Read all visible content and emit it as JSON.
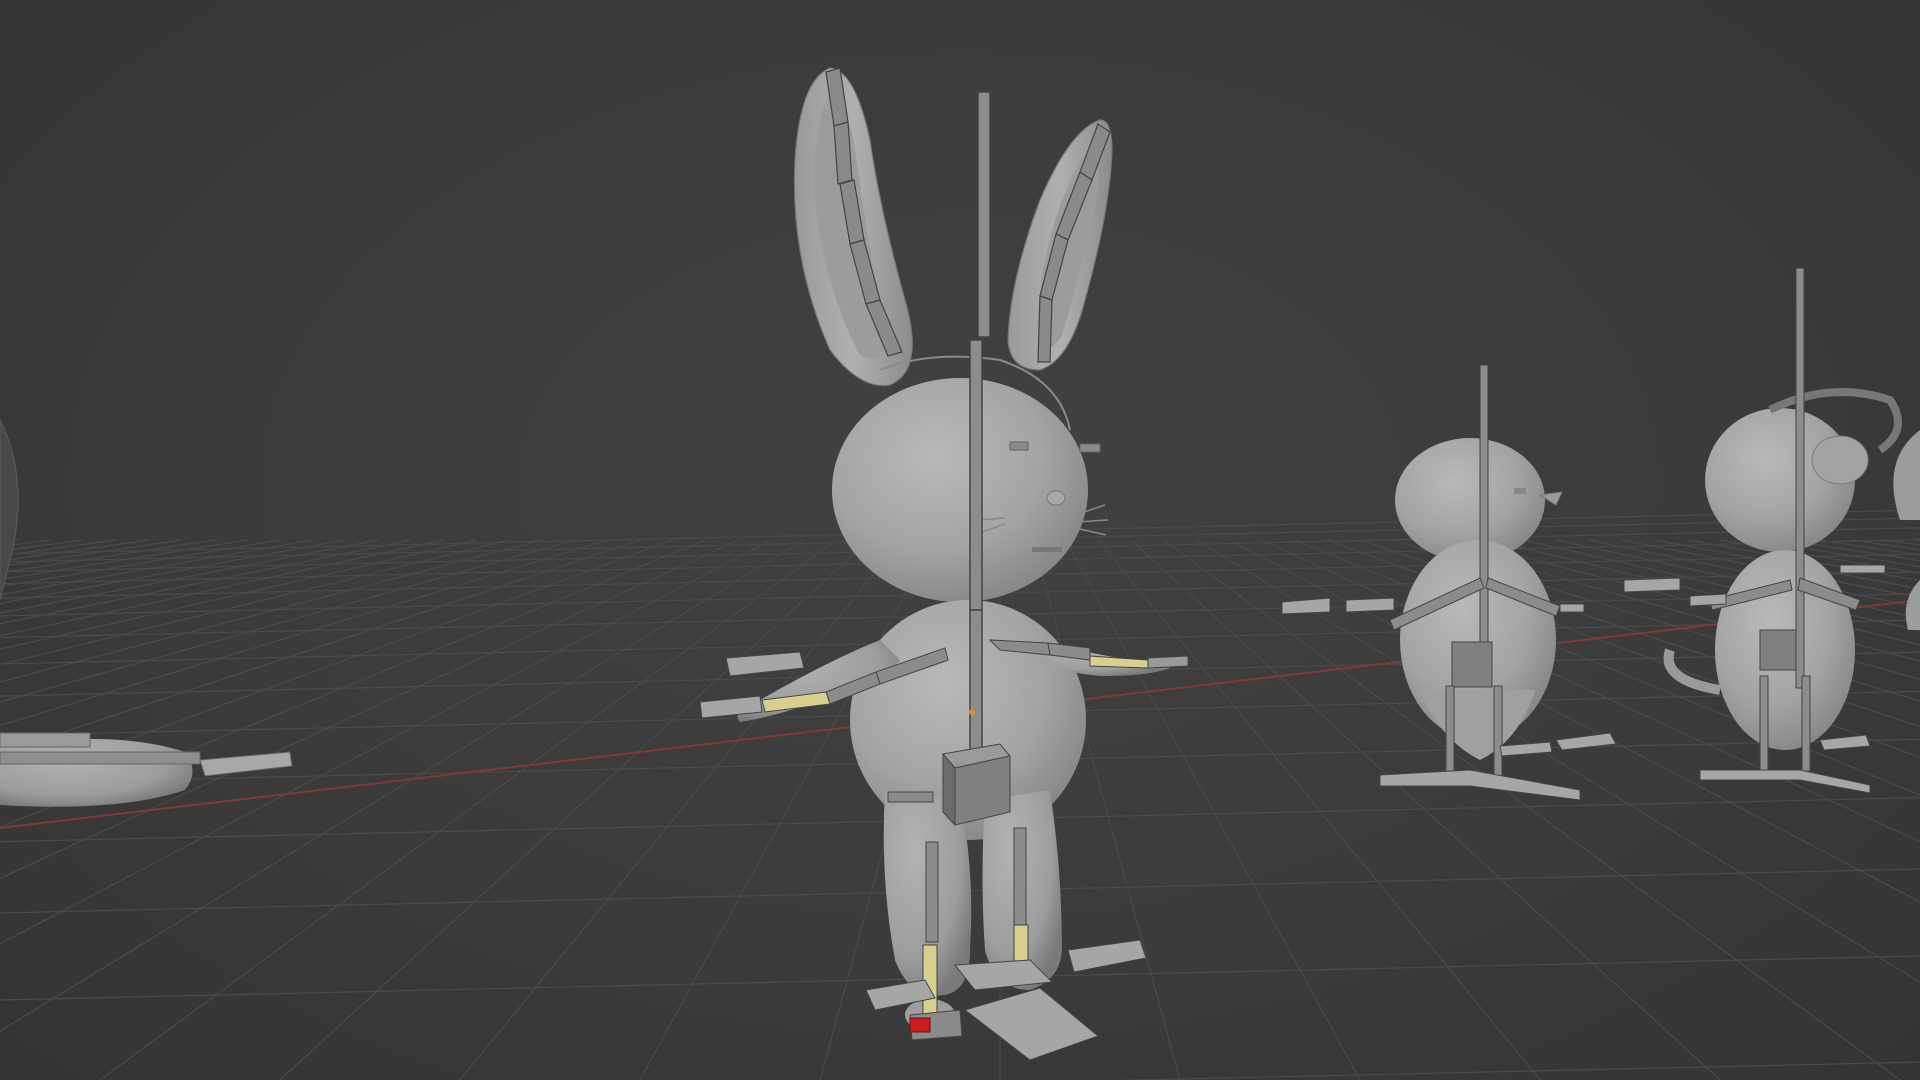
{
  "app": "3D viewport",
  "viewport": {
    "colors": {
      "background": "#3b3b3b",
      "grid_line": "#4a4a4a",
      "x_axis": "#8a3a3a",
      "mesh": "#a9a9a9",
      "mesh_shade": "#7e7e7e",
      "bone": "#8c8c8c",
      "bone_selected": "#c8c28a",
      "bone_active": "#c81e1e"
    },
    "objects": [
      {
        "id": "rabbit",
        "icon": "rabbit-rig"
      },
      {
        "id": "chick",
        "icon": "chick-rig"
      },
      {
        "id": "mouse",
        "icon": "mouse-rig"
      },
      {
        "id": "left-character",
        "icon": "partial-rig"
      }
    ]
  }
}
